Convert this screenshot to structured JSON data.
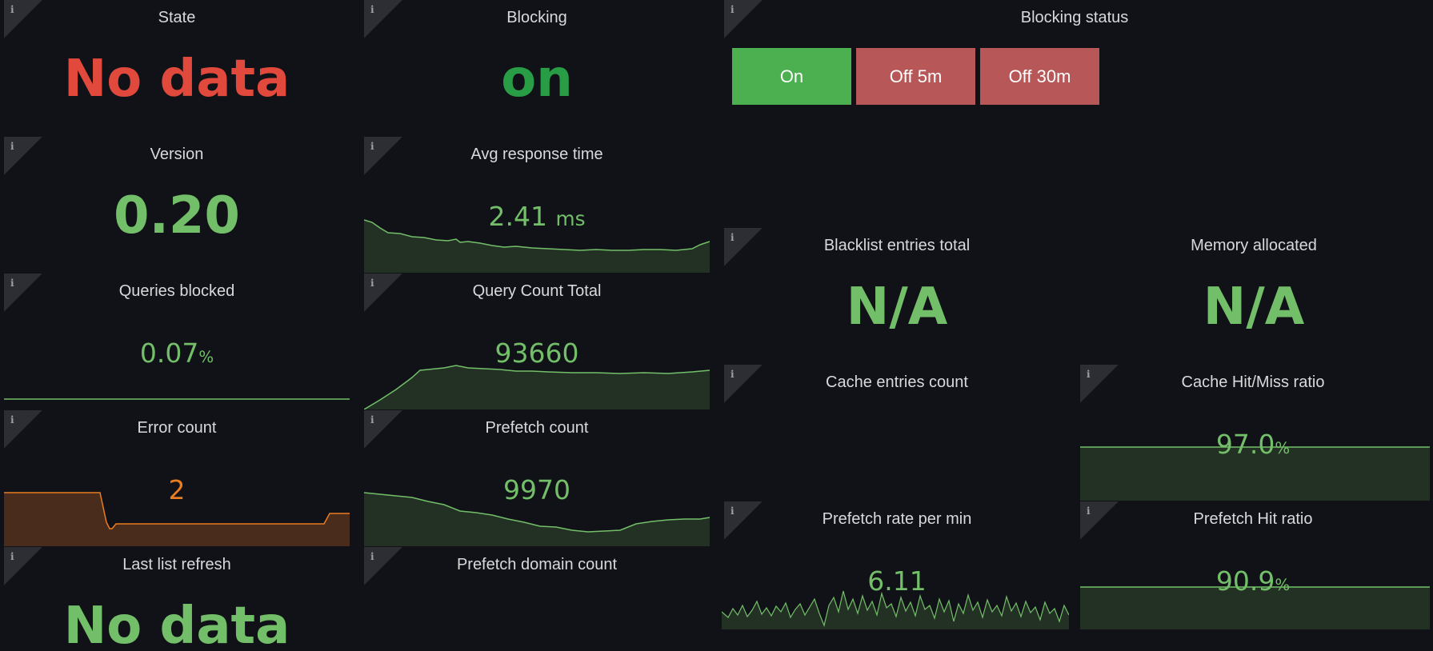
{
  "colors": {
    "green": "#73bf69",
    "red": "#e0493c",
    "orange": "#e87d22",
    "btn_on": "#4caf50",
    "btn_off": "#b75757",
    "bg": "#111217"
  },
  "panels": {
    "state": {
      "title": "State",
      "value": "No data"
    },
    "blocking": {
      "title": "Blocking",
      "value": "on"
    },
    "blocking_status": {
      "title": "Blocking status",
      "buttons": [
        "On",
        "Off 5m",
        "Off 30m"
      ]
    },
    "version": {
      "title": "Version",
      "value": "0.20"
    },
    "avg_response": {
      "title": "Avg response time",
      "value": "2.41",
      "unit": "ms"
    },
    "queries_blocked": {
      "title": "Queries blocked",
      "value": "0.07",
      "unit": "%"
    },
    "query_count": {
      "title": "Query Count Total",
      "value": "93660"
    },
    "error_count": {
      "title": "Error count",
      "value": "2"
    },
    "prefetch_count": {
      "title": "Prefetch count",
      "value": "9970"
    },
    "last_refresh": {
      "title": "Last list refresh",
      "value": "No data"
    },
    "prefetch_domain": {
      "title": "Prefetch domain count",
      "value": ""
    },
    "blacklist": {
      "title": "Blacklist entries total",
      "value": "N/A"
    },
    "memory": {
      "title": "Memory allocated",
      "value": "N/A"
    },
    "cache_entries": {
      "title": "Cache entries count",
      "value": ""
    },
    "cache_hit": {
      "title": "Cache Hit/Miss ratio",
      "value": "97.0",
      "unit": "%"
    },
    "prefetch_rate": {
      "title": "Prefetch rate per min",
      "value": "6.11"
    },
    "prefetch_hit": {
      "title": "Prefetch Hit ratio",
      "value": "90.9",
      "unit": "%"
    }
  }
}
